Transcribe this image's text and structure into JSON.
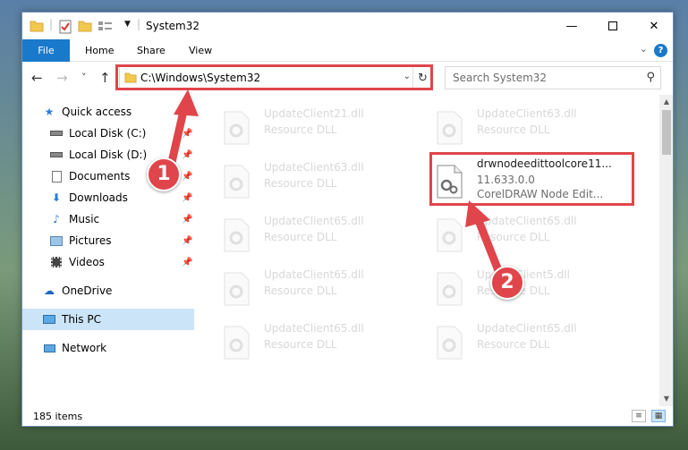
{
  "window": {
    "title": "System32",
    "ribbon_tabs": [
      "File",
      "Home",
      "Share",
      "View"
    ],
    "help": "?"
  },
  "nav": {
    "back": "←",
    "forward": "→",
    "recent": "˅",
    "up": "↑",
    "address": "C:\\Windows\\System32",
    "search_placeholder": "Search System32",
    "refresh": "↻"
  },
  "sidebar": {
    "items": [
      {
        "label": "Quick access",
        "icon": "star-icon",
        "pinned": false
      },
      {
        "label": "Local Disk (C:)",
        "icon": "drive-icon",
        "pinned": true
      },
      {
        "label": "Local Disk (D:)",
        "icon": "drive-icon",
        "pinned": true
      },
      {
        "label": "Documents",
        "icon": "documents-icon",
        "pinned": true
      },
      {
        "label": "Downloads",
        "icon": "download-icon",
        "pinned": true
      },
      {
        "label": "Music",
        "icon": "music-icon",
        "pinned": true
      },
      {
        "label": "Pictures",
        "icon": "pictures-icon",
        "pinned": true
      },
      {
        "label": "Videos",
        "icon": "video-icon",
        "pinned": true
      },
      {
        "label": "OneDrive",
        "icon": "cloud-icon",
        "pinned": false
      },
      {
        "label": "This PC",
        "icon": "computer-icon",
        "pinned": false,
        "selected": true
      },
      {
        "label": "Network",
        "icon": "network-icon",
        "pinned": false
      }
    ]
  },
  "files": [
    {
      "name": "UpdateClient21.dll",
      "desc": "Resource DLL"
    },
    {
      "name": "UpdateClient63.dll",
      "desc": "Resource DLL"
    },
    {
      "name": "UpdateClient63.dll",
      "desc": "Resource DLL"
    },
    {
      "name": "drwnodeedittoolcore11...",
      "version": "11.633.0.0",
      "desc": "CorelDRAW Node Edit...",
      "highlighted": true
    },
    {
      "name": "UpdateClient65.dll",
      "desc": "Resource DLL"
    },
    {
      "name": "UpdateClient65.dll",
      "desc": "Resource DLL"
    },
    {
      "name": "UpdateClient65.dll",
      "desc": "Resource DLL"
    },
    {
      "name": "UpdateClient5.dll",
      "desc": "Resource DLL"
    },
    {
      "name": "UpdateClient65.dll",
      "desc": "Resource DLL"
    },
    {
      "name": "UpdateClient65.dll",
      "desc": "Resource DLL"
    }
  ],
  "status": {
    "item_count": "185 items"
  },
  "annotations": {
    "step1": "1",
    "step2": "2",
    "color": "#e0454b"
  }
}
